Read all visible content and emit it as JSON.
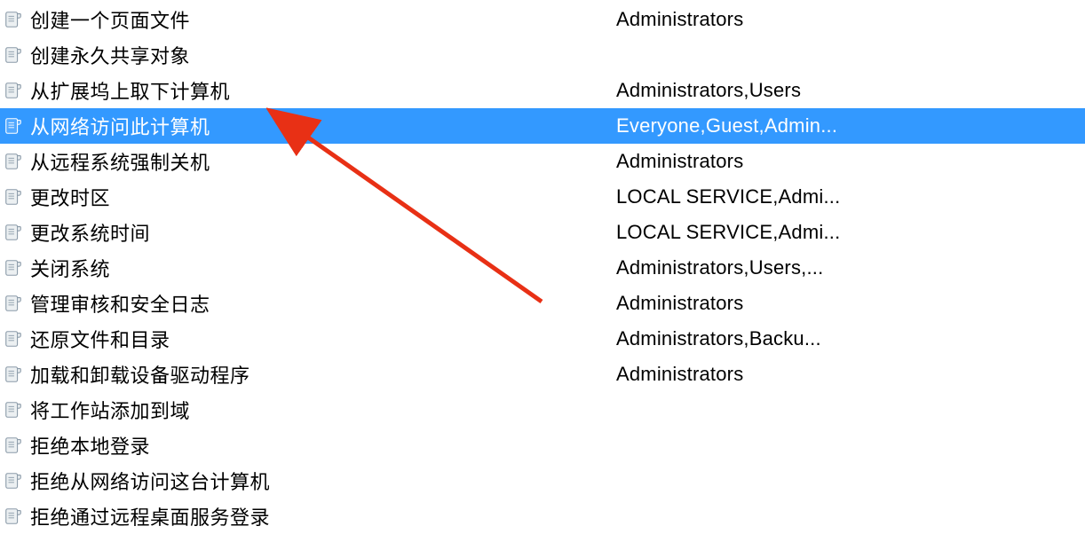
{
  "policies": [
    {
      "name": "创建一个页面文件",
      "setting": "Administrators",
      "selected": false
    },
    {
      "name": "创建永久共享对象",
      "setting": "",
      "selected": false
    },
    {
      "name": "从扩展坞上取下计算机",
      "setting": "Administrators,Users",
      "selected": false
    },
    {
      "name": "从网络访问此计算机",
      "setting": "Everyone,Guest,Admin...",
      "selected": true
    },
    {
      "name": "从远程系统强制关机",
      "setting": "Administrators",
      "selected": false
    },
    {
      "name": "更改时区",
      "setting": "LOCAL SERVICE,Admi...",
      "selected": false
    },
    {
      "name": "更改系统时间",
      "setting": "LOCAL SERVICE,Admi...",
      "selected": false
    },
    {
      "name": "关闭系统",
      "setting": "Administrators,Users,...",
      "selected": false
    },
    {
      "name": "管理审核和安全日志",
      "setting": "Administrators",
      "selected": false
    },
    {
      "name": "还原文件和目录",
      "setting": "Administrators,Backu...",
      "selected": false
    },
    {
      "name": "加载和卸载设备驱动程序",
      "setting": "Administrators",
      "selected": false
    },
    {
      "name": "将工作站添加到域",
      "setting": "",
      "selected": false
    },
    {
      "name": "拒绝本地登录",
      "setting": "",
      "selected": false
    },
    {
      "name": "拒绝从网络访问这台计算机",
      "setting": "",
      "selected": false
    },
    {
      "name": "拒绝通过远程桌面服务登录",
      "setting": "",
      "selected": false
    }
  ]
}
